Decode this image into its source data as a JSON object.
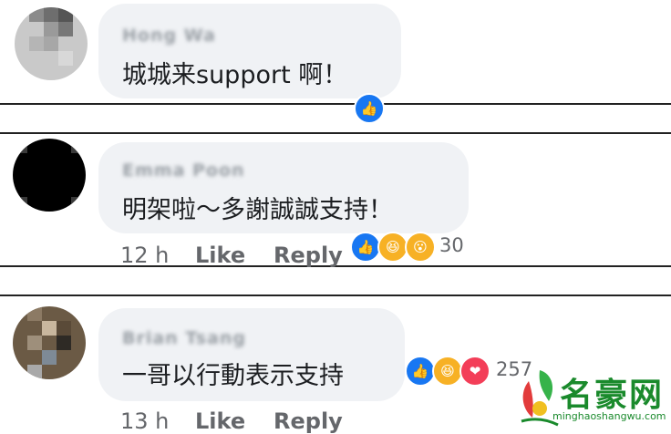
{
  "comments": [
    {
      "author": "Hong Wa",
      "text": "城城来support 啊！",
      "time": "",
      "like_label": "",
      "reply_label": "",
      "reactions": {
        "icons": [
          "like-icon"
        ],
        "count": ""
      }
    },
    {
      "author": "Emma Poon",
      "text": "明架啦～多謝誠誠支持！",
      "time": "12 h",
      "like_label": "Like",
      "reply_label": "Reply",
      "reactions": {
        "icons": [
          "like-icon",
          "haha-icon",
          "wow-icon"
        ],
        "count": "30"
      }
    },
    {
      "author": "Brian Tsang",
      "text": "一哥以行動表示支持",
      "time": "13 h",
      "like_label": "Like",
      "reply_label": "Reply",
      "reactions": {
        "icons": [
          "like-icon",
          "haha-icon",
          "love-icon"
        ],
        "count": "257"
      }
    }
  ],
  "watermark": {
    "title": "名豪网",
    "url": "minghaoshangwu.com"
  },
  "colors": {
    "bubble": "#f0f2f5",
    "like": "#1877f2",
    "haha": "#f7b125",
    "love": "#f33e58",
    "watermark": "#1a8a2c"
  }
}
